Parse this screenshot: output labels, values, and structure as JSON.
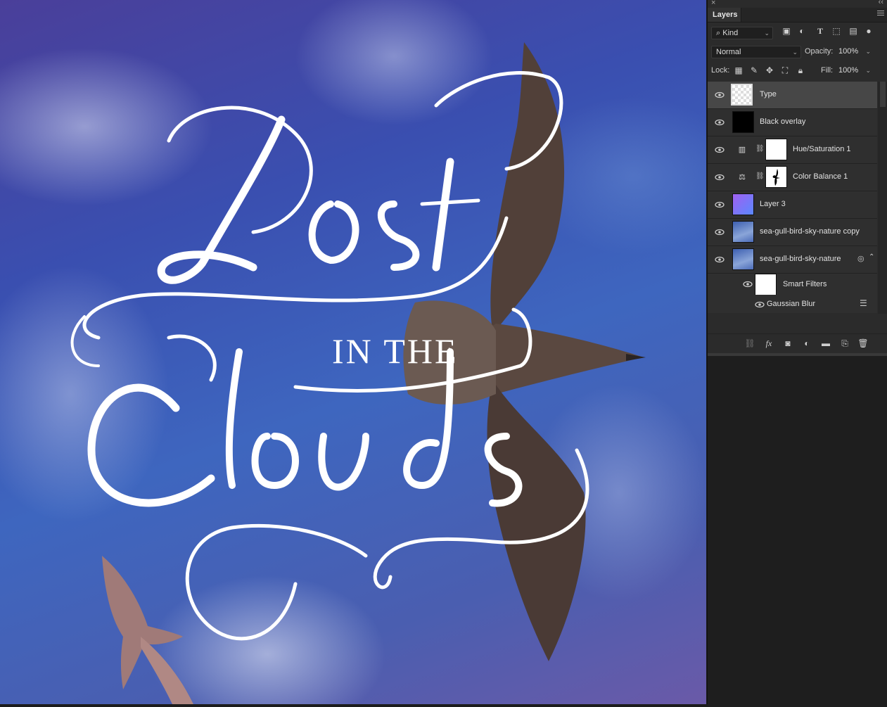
{
  "artwork": {
    "headline_word1": "Lost",
    "headline_middle": "IN THE",
    "headline_word2": "Clouds"
  },
  "panel": {
    "tab_label": "Layers",
    "filter_kind": "Kind",
    "blend_mode": "Normal",
    "opacity_label": "Opacity:",
    "opacity_value": "100%",
    "lock_label": "Lock:",
    "fill_label": "Fill:",
    "fill_value": "100%"
  },
  "layers": [
    {
      "name": "Type",
      "thumb": "transparent",
      "selected": true
    },
    {
      "name": "Black overlay",
      "thumb": "black"
    },
    {
      "name": "Hue/Saturation 1",
      "thumb": "white",
      "adjustment": "hue-saturation"
    },
    {
      "name": "Color Balance 1",
      "thumb": "bird-mask",
      "adjustment": "color-balance"
    },
    {
      "name": "Layer 3",
      "thumb": "gradient"
    },
    {
      "name": "sea-gull-bird-sky-nature copy",
      "thumb": "photo"
    },
    {
      "name": "sea-gull-bird-sky-nature",
      "thumb": "photo-smart"
    }
  ],
  "smart_filters": {
    "label": "Smart Filters",
    "filter_name": "Gaussian Blur"
  },
  "colors": {
    "panel_bg": "#2b2b2b",
    "selected_row": "#474747",
    "sky_blue": "#3e66bf"
  }
}
